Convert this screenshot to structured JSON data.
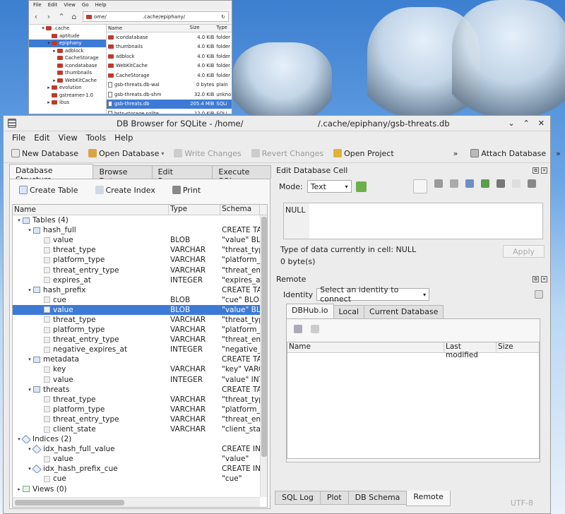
{
  "file_manager": {
    "menu": [
      "File",
      "Edit",
      "View",
      "Go",
      "Help"
    ],
    "path_left": "ome/",
    "path_right": ".cache/epiphany/",
    "tree": [
      {
        "label": ".cache",
        "indent": 2,
        "arrow": "▾",
        "selected": false
      },
      {
        "label": "aptitude",
        "indent": 3,
        "arrow": "",
        "selected": false
      },
      {
        "label": "epiphany",
        "indent": 3,
        "arrow": "▾",
        "selected": true
      },
      {
        "label": "adblock",
        "indent": 4,
        "arrow": "▸",
        "selected": false
      },
      {
        "label": "CacheStorage",
        "indent": 4,
        "arrow": "",
        "selected": false
      },
      {
        "label": "icondatabase",
        "indent": 4,
        "arrow": "",
        "selected": false
      },
      {
        "label": "thumbnails",
        "indent": 4,
        "arrow": "",
        "selected": false
      },
      {
        "label": "WebKitCache",
        "indent": 4,
        "arrow": "▸",
        "selected": false
      },
      {
        "label": "evolution",
        "indent": 3,
        "arrow": "▸",
        "selected": false
      },
      {
        "label": "gstreamer-1.0",
        "indent": 3,
        "arrow": "",
        "selected": false
      },
      {
        "label": "ibus",
        "indent": 3,
        "arrow": "▸",
        "selected": false
      }
    ],
    "headers": [
      "Name",
      "Size",
      "Type"
    ],
    "files": [
      {
        "name": "icondatabase",
        "size": "4.0 KiB",
        "type": "folder",
        "folder": true,
        "selected": false
      },
      {
        "name": "thumbnails",
        "size": "4.0 KiB",
        "type": "folder",
        "folder": true,
        "selected": false
      },
      {
        "name": "adblock",
        "size": "4.0 KiB",
        "type": "folder",
        "folder": true,
        "selected": false
      },
      {
        "name": "WebKitCache",
        "size": "4.0 KiB",
        "type": "folder",
        "folder": true,
        "selected": false
      },
      {
        "name": "CacheStorage",
        "size": "4.0 KiB",
        "type": "folder",
        "folder": true,
        "selected": false
      },
      {
        "name": "gsb-threats.db-wal",
        "size": "0 bytes",
        "type": "plain",
        "folder": false,
        "selected": false
      },
      {
        "name": "gsb-threats.db-shm",
        "size": "32.0 KiB",
        "type": "unkno",
        "folder": false,
        "selected": false
      },
      {
        "name": "gsb-threats.db",
        "size": "205.4 MiB",
        "type": "SQLi",
        "folder": false,
        "selected": true
      },
      {
        "name": "hsts-storage.sqlite",
        "size": "12.0 KiB",
        "type": "SQLi",
        "folder": false,
        "selected": false
      }
    ]
  },
  "window": {
    "title_left": "DB Browser for SQLite - /home/",
    "title_right": "/.cache/epiphany/gsb-threats.db",
    "controls": [
      "⌄",
      "⌃",
      "✕"
    ]
  },
  "menu": [
    "File",
    "Edit",
    "View",
    "Tools",
    "Help"
  ],
  "toolbar": {
    "new_db": "New Database",
    "open_db": "Open Database",
    "write": "Write Changes",
    "revert": "Revert Changes",
    "open_project": "Open Project",
    "attach": "Attach Database",
    "more": "»"
  },
  "left_tabs": [
    "Database Structure",
    "Browse Data",
    "Edit Pragmas",
    "Execute SQL"
  ],
  "subtoolbar": {
    "create_table": "Create Table",
    "create_index": "Create Index",
    "print": "Print"
  },
  "tree_headers": [
    "Name",
    "Type",
    "Schema"
  ],
  "tree_rows": [
    {
      "level": 0,
      "arrow": "▾",
      "icon": "table",
      "name": "Tables (4)",
      "type": "",
      "schema": ""
    },
    {
      "level": 1,
      "arrow": "▾",
      "icon": "table",
      "name": "hash_full",
      "type": "",
      "schema": "CREATE TA"
    },
    {
      "level": 2,
      "arrow": "",
      "icon": "field",
      "name": "value",
      "type": "BLOB",
      "schema": "\"value\" BL"
    },
    {
      "level": 2,
      "arrow": "",
      "icon": "field",
      "name": "threat_type",
      "type": "VARCHAR",
      "schema": "\"threat_typ"
    },
    {
      "level": 2,
      "arrow": "",
      "icon": "field",
      "name": "platform_type",
      "type": "VARCHAR",
      "schema": "\"platform_t"
    },
    {
      "level": 2,
      "arrow": "",
      "icon": "field",
      "name": "threat_entry_type",
      "type": "VARCHAR",
      "schema": "\"threat_ent"
    },
    {
      "level": 2,
      "arrow": "",
      "icon": "field",
      "name": "expires_at",
      "type": "INTEGER",
      "schema": "\"expires_at"
    },
    {
      "level": 1,
      "arrow": "▾",
      "icon": "table",
      "name": "hash_prefix",
      "type": "",
      "schema": "CREATE TA"
    },
    {
      "level": 2,
      "arrow": "",
      "icon": "field",
      "name": "cue",
      "type": "BLOB",
      "schema": "\"cue\" BLOB"
    },
    {
      "level": 2,
      "arrow": "",
      "icon": "field",
      "name": "value",
      "type": "BLOB",
      "schema": "\"value\" BL",
      "selected": true
    },
    {
      "level": 2,
      "arrow": "",
      "icon": "field",
      "name": "threat_type",
      "type": "VARCHAR",
      "schema": "\"threat_typ"
    },
    {
      "level": 2,
      "arrow": "",
      "icon": "field",
      "name": "platform_type",
      "type": "VARCHAR",
      "schema": "\"platform_t"
    },
    {
      "level": 2,
      "arrow": "",
      "icon": "field",
      "name": "threat_entry_type",
      "type": "VARCHAR",
      "schema": "\"threat_ent"
    },
    {
      "level": 2,
      "arrow": "",
      "icon": "field",
      "name": "negative_expires_at",
      "type": "INTEGER",
      "schema": "\"negative_"
    },
    {
      "level": 1,
      "arrow": "▾",
      "icon": "table",
      "name": "metadata",
      "type": "",
      "schema": "CREATE TA"
    },
    {
      "level": 2,
      "arrow": "",
      "icon": "field",
      "name": "key",
      "type": "VARCHAR",
      "schema": "\"key\" VARC"
    },
    {
      "level": 2,
      "arrow": "",
      "icon": "field",
      "name": "value",
      "type": "INTEGER",
      "schema": "\"value\" INT"
    },
    {
      "level": 1,
      "arrow": "▾",
      "icon": "table",
      "name": "threats",
      "type": "",
      "schema": "CREATE TA"
    },
    {
      "level": 2,
      "arrow": "",
      "icon": "field",
      "name": "threat_type",
      "type": "VARCHAR",
      "schema": "\"threat_typ"
    },
    {
      "level": 2,
      "arrow": "",
      "icon": "field",
      "name": "platform_type",
      "type": "VARCHAR",
      "schema": "\"platform_t"
    },
    {
      "level": 2,
      "arrow": "",
      "icon": "field",
      "name": "threat_entry_type",
      "type": "VARCHAR",
      "schema": "\"threat_ent"
    },
    {
      "level": 2,
      "arrow": "",
      "icon": "field",
      "name": "client_state",
      "type": "VARCHAR",
      "schema": "\"client_stat"
    },
    {
      "level": 0,
      "arrow": "▾",
      "icon": "index",
      "name": "Indices (2)",
      "type": "",
      "schema": ""
    },
    {
      "level": 1,
      "arrow": "▾",
      "icon": "index",
      "name": "idx_hash_full_value",
      "type": "",
      "schema": "CREATE INI"
    },
    {
      "level": 2,
      "arrow": "",
      "icon": "field",
      "name": "value",
      "type": "",
      "schema": "\"value\""
    },
    {
      "level": 1,
      "arrow": "▾",
      "icon": "index",
      "name": "idx_hash_prefix_cue",
      "type": "",
      "schema": "CREATE INI"
    },
    {
      "level": 2,
      "arrow": "",
      "icon": "field",
      "name": "cue",
      "type": "",
      "schema": "\"cue\""
    },
    {
      "level": 0,
      "arrow": "▸",
      "icon": "view",
      "name": "Views (0)",
      "type": "",
      "schema": ""
    }
  ],
  "edit_cell": {
    "title": "Edit Database Cell",
    "mode_label": "Mode:",
    "mode_value": "Text",
    "null_label": "NULL",
    "type_info": "Type of data currently in cell: NULL",
    "size_info": "0 byte(s)",
    "apply": "Apply"
  },
  "remote": {
    "title": "Remote",
    "identity_label": "Identity",
    "identity_value": "Select an identity to connect",
    "tabs": [
      "DBHub.io",
      "Local",
      "Current Database"
    ],
    "headers": [
      "Name",
      "Last modified",
      "Size"
    ]
  },
  "bottom_tabs": [
    "SQL Log",
    "Plot",
    "DB Schema",
    "Remote"
  ],
  "status": "UTF-8",
  "colors": {
    "selection": "#3d7ad6",
    "folder": "#c0392b"
  }
}
